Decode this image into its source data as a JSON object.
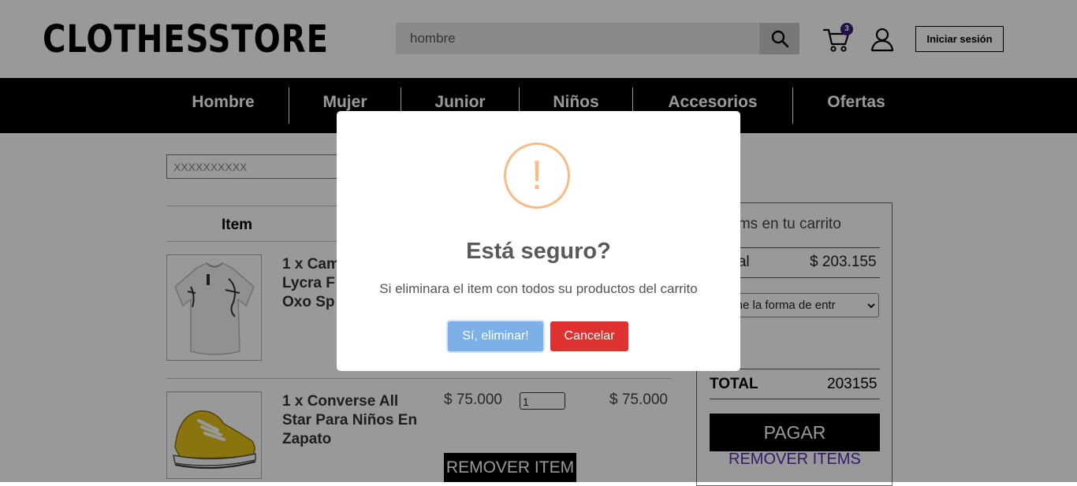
{
  "header": {
    "logo": "CLOTHESSTORE",
    "search_value": "hombre",
    "cart_count": "3",
    "login_label": "Iniciar sesión"
  },
  "nav": {
    "items": [
      "Hombre",
      "Mujer",
      "Junior",
      "Niños",
      "Accesorios",
      "Ofertas"
    ]
  },
  "cart": {
    "coupon_placeholder": "XXXXXXXXXX",
    "column_item": "Item",
    "products": [
      {
        "name_lines": [
          "1 x Cam",
          "Lycra F",
          "Oxo Sp"
        ]
      },
      {
        "name_lines": [
          "1 x Converse All",
          "Star Para Niños En",
          "Zapato"
        ],
        "price": "$ 75.000",
        "qty": "1",
        "total": "$ 75.000"
      }
    ],
    "remove_item_label": "REMOVER ITEM"
  },
  "summary": {
    "title": "tems en tu carrito",
    "subtotal_label": "otal",
    "subtotal_value": "$ 203.155",
    "delivery_select": "ccione la forma de entr",
    "total_label": "TOTAL",
    "total_value": "203155",
    "pay_label": "PAGAR",
    "remove_all_label": "REMOVER ITEMS"
  },
  "modal": {
    "icon": "!",
    "title": "Está seguro?",
    "text": "Si eliminara el item con todos su productos del carrito",
    "confirm_label": "Sí, eliminar!",
    "cancel_label": "Cancelar"
  },
  "colors": {
    "confirm": "#7cb0e6",
    "cancel": "#e03131",
    "warning": "#f8bb86",
    "badge": "#3b1d7a",
    "remove_all": "#5a2ab5"
  }
}
